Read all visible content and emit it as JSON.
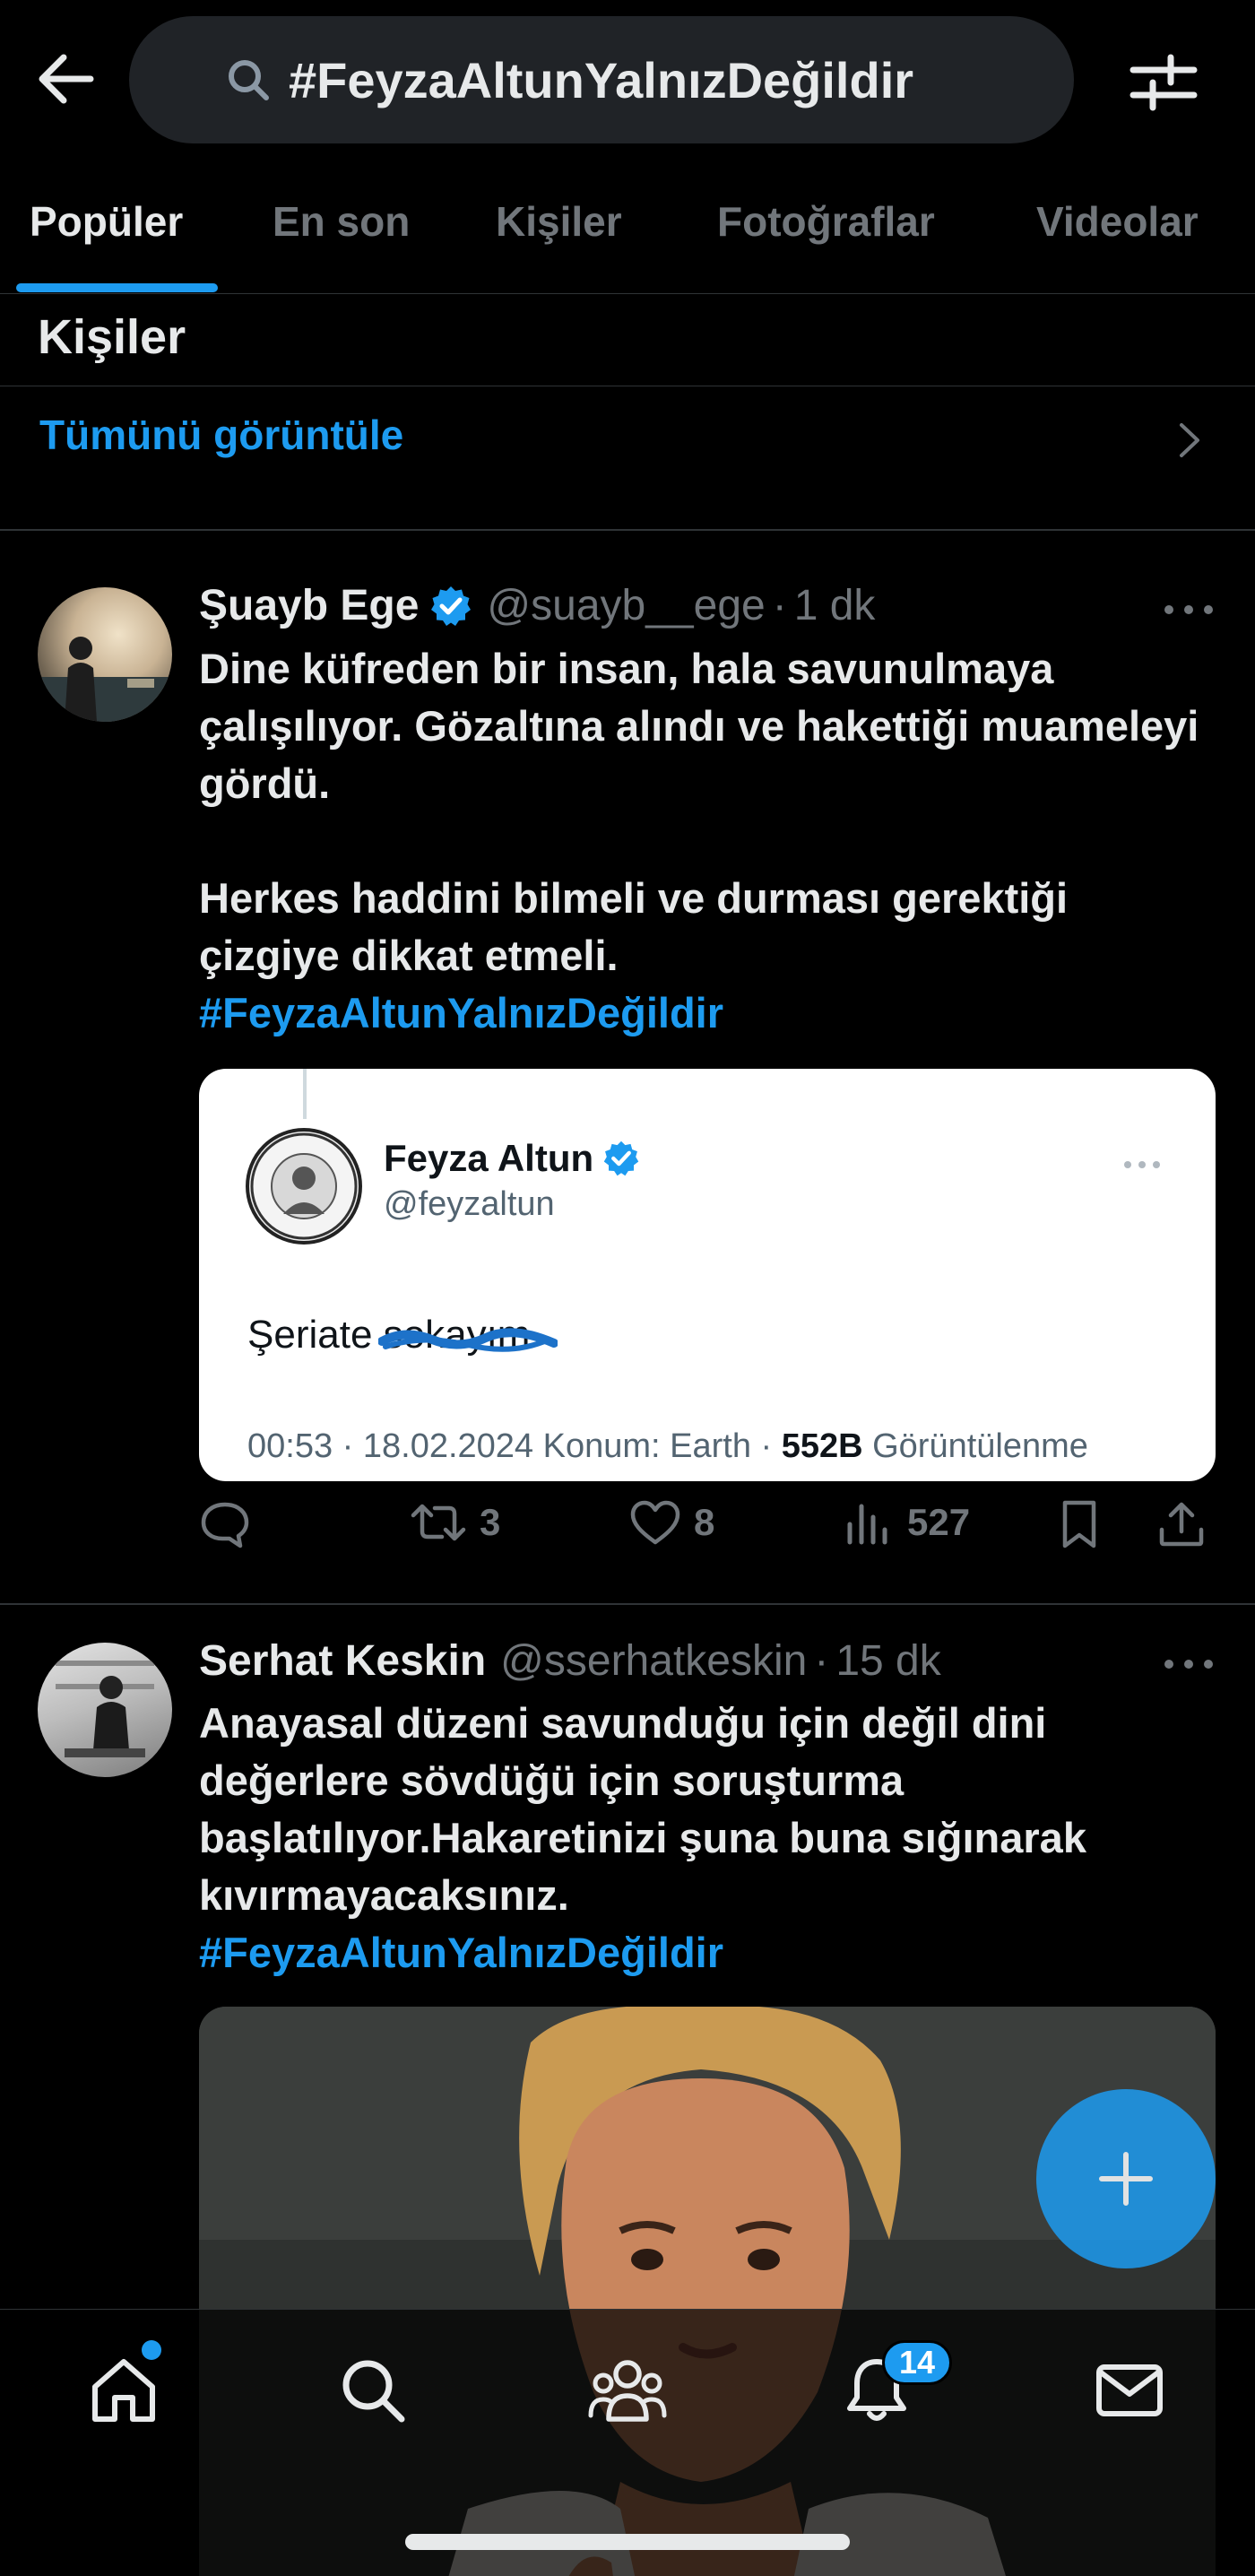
{
  "search": {
    "query": "#FeyzaAltunYalnızDeğildir"
  },
  "tabs": [
    {
      "label": "Popüler"
    },
    {
      "label": "En son"
    },
    {
      "label": "Kişiler"
    },
    {
      "label": "Fotoğraflar"
    },
    {
      "label": "Videolar"
    }
  ],
  "people": {
    "title": "Kişiler",
    "view_all": "Tümünü görüntüle"
  },
  "tweets": [
    {
      "name": "Şuayb Ege",
      "verified": true,
      "handle": "@suayb__ege",
      "time": "1 dk",
      "text": "Dine küfreden bir insan, hala savunulmaya çalışılıyor. Gözaltına alındı ve hakettiği muameleyi gördü.\n\nHerkes haddini bilmeli ve durması gerektiği çizgiye dikkat etmeli.",
      "hashtag": "#FeyzaAltunYalnızDeğildir",
      "embed": {
        "name": "Feyza Altun",
        "handle": "@feyzaltun",
        "text_visible": "Şeriate ",
        "text_struck": "sokayım",
        "meta_prefix": "00:53 · 18.02.2024 Konum: Earth · ",
        "views": "552B",
        "views_label": " Görüntülenme"
      },
      "stats": {
        "retweets": "3",
        "likes": "8",
        "views": "527"
      }
    },
    {
      "name": "Serhat Keskin",
      "verified": false,
      "handle": "@sserhatkeskin",
      "time": "15 dk",
      "text": "Anayasal düzeni savunduğu için değil dini değerlere sövdüğü için soruşturma başlatılıyor.Hakaretinizi şuna buna sığınarak kıvırmayacaksınız.",
      "hashtag": "#FeyzaAltunYalnızDeğildir"
    }
  ],
  "nav": {
    "notifications_badge": "14"
  },
  "colors": {
    "accent": "#1d9bf0",
    "background": "#000000",
    "muted": "#71767b"
  }
}
